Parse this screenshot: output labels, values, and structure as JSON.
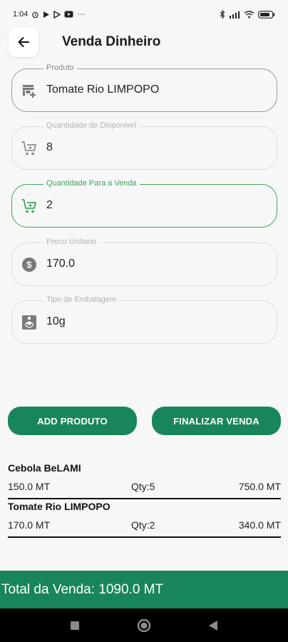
{
  "status_bar": {
    "time": "1:04",
    "more_indicator": "···"
  },
  "header": {
    "title": "Venda Dinheiro"
  },
  "form": {
    "produto": {
      "label": "Produto",
      "value": "Tomate Rio LIMPOPO"
    },
    "quantidade_disponivel": {
      "label": "Quantidade de Disponivel",
      "value": "8"
    },
    "quantidade_venda": {
      "label": "Quantidade Para a Venda",
      "value": "2"
    },
    "preco_unitario": {
      "label": "Preco Unitario",
      "value": "170.0"
    },
    "tipo_embalagem": {
      "label": "Tipo de Embalagem",
      "value": "10g"
    }
  },
  "actions": {
    "add_label": "ADD PRODUTO",
    "finalize_label": "FINALIZAR VENDA"
  },
  "items": [
    {
      "name": "Cebola BeLAMI",
      "price": "150.0 MT",
      "qty": "Qty:5",
      "total": "750.0 MT"
    },
    {
      "name": "Tomate Rio LIMPOPO",
      "price": "170.0 MT",
      "qty": "Qty:2",
      "total": "340.0 MT"
    }
  ],
  "footer": {
    "total_text": "Total da Venda: 1090.0 MT"
  },
  "colors": {
    "primary": "#18865a",
    "focus": "#3fa45a"
  },
  "icons": {
    "back": "arrow-left-icon",
    "produto": "store-icon",
    "quantidade_disponivel": "cart-icon",
    "quantidade_venda": "cart-icon",
    "preco_unitario": "dollar-circle-icon",
    "tipo_embalagem": "package-icon"
  }
}
